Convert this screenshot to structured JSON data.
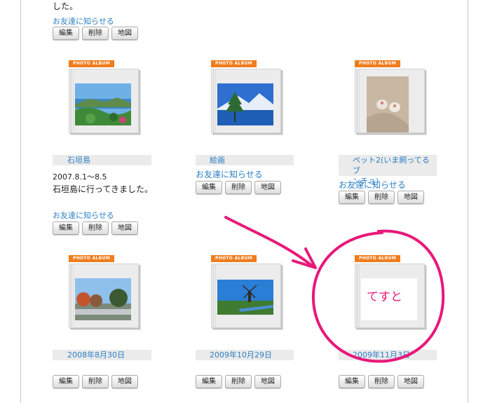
{
  "top": {
    "text_fragment": "した。",
    "notify_link": "お友達に知らせる"
  },
  "buttons": {
    "edit": "編集",
    "delete": "削除",
    "map": "地図"
  },
  "album_tag": "PHOTO ALBUM",
  "albums": [
    {
      "title": "石垣島",
      "date": "2007.8.1〜8.5",
      "description": "石垣島に行ってきました。",
      "notify": "お友達に知らせる"
    },
    {
      "title": "絵画",
      "notify": "お友達に知らせる"
    },
    {
      "title_line1": "ペット2(いま飼ってるブ",
      "title_line2": "ンチョ)",
      "notify": "お友達に知らせる"
    },
    {
      "title": "2008年8月30日"
    },
    {
      "title": "2009年10月29日"
    },
    {
      "title": "2009年11月3日"
    }
  ],
  "annotation": {
    "handwritten_text": "てすと",
    "color": "#e8197a"
  }
}
